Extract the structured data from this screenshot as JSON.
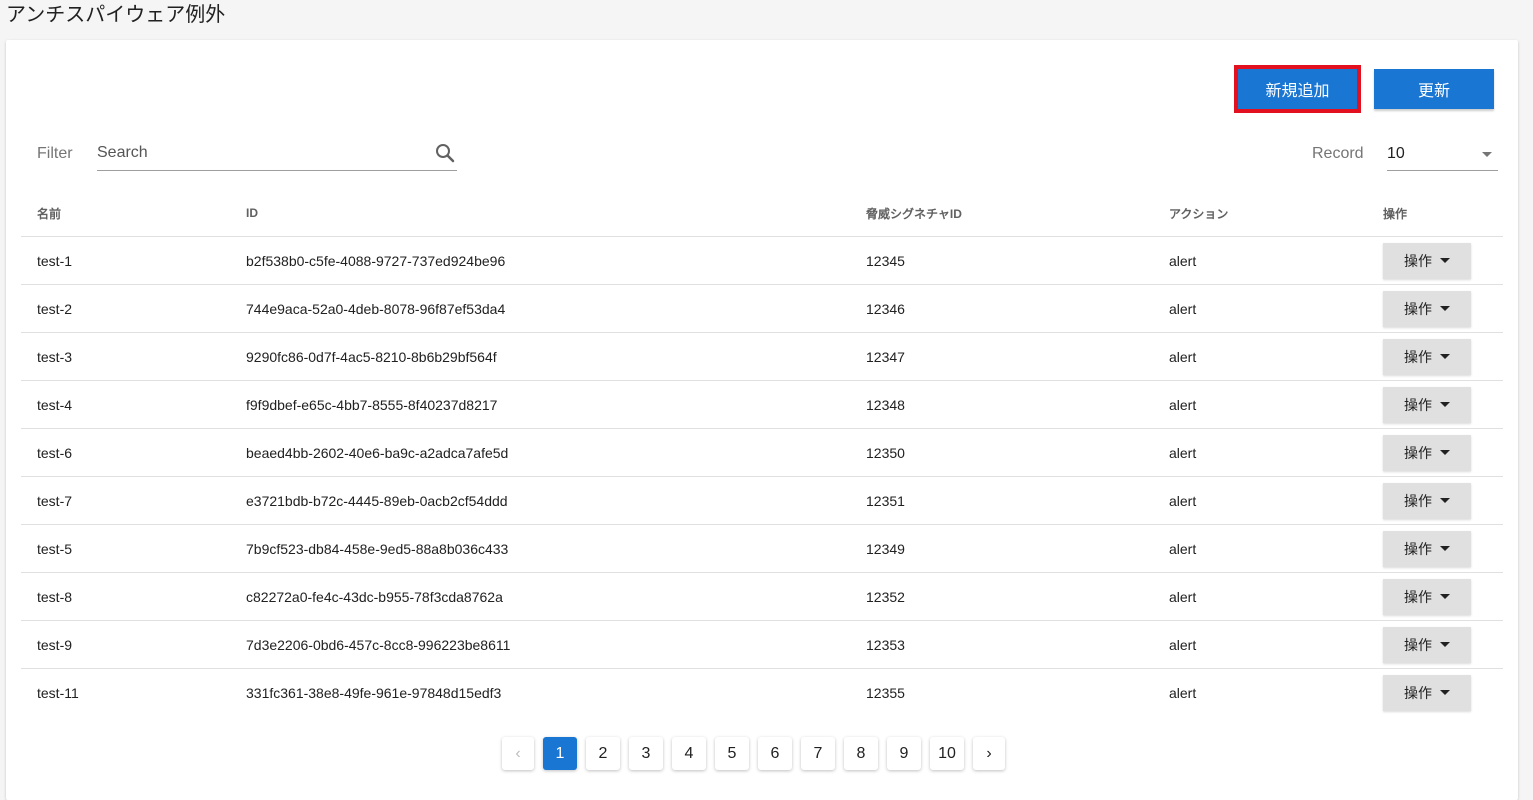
{
  "page_title": "アンチスパイウェア例外",
  "toolbar": {
    "add_label": "新規追加",
    "refresh_label": "更新"
  },
  "filter": {
    "label": "Filter",
    "search_placeholder": "Search"
  },
  "record": {
    "label": "Record",
    "value": "10"
  },
  "table": {
    "headers": [
      "名前",
      "ID",
      "脅威シグネチャID",
      "アクション",
      "操作"
    ],
    "op_label": "操作",
    "rows": [
      [
        "test-1",
        "b2f538b0-c5fe-4088-9727-737ed924be96",
        "12345",
        "alert"
      ],
      [
        "test-2",
        "744e9aca-52a0-4deb-8078-96f87ef53da4",
        "12346",
        "alert"
      ],
      [
        "test-3",
        "9290fc86-0d7f-4ac5-8210-8b6b29bf564f",
        "12347",
        "alert"
      ],
      [
        "test-4",
        "f9f9dbef-e65c-4bb7-8555-8f40237d8217",
        "12348",
        "alert"
      ],
      [
        "test-6",
        "beaed4bb-2602-40e6-ba9c-a2adca7afe5d",
        "12350",
        "alert"
      ],
      [
        "test-7",
        "e3721bdb-b72c-4445-89eb-0acb2cf54ddd",
        "12351",
        "alert"
      ],
      [
        "test-5",
        "7b9cf523-db84-458e-9ed5-88a8b036c433",
        "12349",
        "alert"
      ],
      [
        "test-8",
        "c82272a0-fe4c-43dc-b955-78f3cda8762a",
        "12352",
        "alert"
      ],
      [
        "test-9",
        "7d3e2206-0bd6-457c-8cc8-996223be8611",
        "12353",
        "alert"
      ],
      [
        "test-11",
        "331fc361-38e8-49fe-961e-97848d15edf3",
        "12355",
        "alert"
      ]
    ]
  },
  "pagination": {
    "prev": "‹",
    "next": "›",
    "pages": [
      "1",
      "2",
      "3",
      "4",
      "5",
      "6",
      "7",
      "8",
      "9",
      "10"
    ],
    "current": "1"
  },
  "colors": {
    "primary": "#1976d2",
    "highlight": "#e3101f"
  }
}
